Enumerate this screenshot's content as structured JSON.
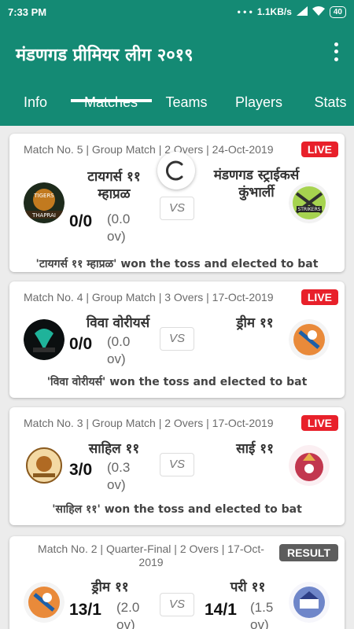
{
  "status_bar": {
    "time": "7:33 PM",
    "dots": "• • •",
    "speed": "1.1KB/s",
    "battery": "40"
  },
  "app": {
    "title": "मंडणगड प्रीमियर लीग २०१९"
  },
  "tabs": [
    {
      "label": "Info"
    },
    {
      "label": "Matches",
      "selected": true
    },
    {
      "label": "Teams"
    },
    {
      "label": "Players"
    },
    {
      "label": "Stats"
    }
  ],
  "matches": [
    {
      "meta": "Match No. 5 | Group Match | 2 Overs | 24-Oct-2019",
      "status": "LIVE",
      "team1": {
        "name": "टायगर्स ११ म्हाप्रळ",
        "score": "0/0",
        "overs": "(0.0 ov)"
      },
      "vs": "VS",
      "team2": {
        "name": "मंडणगड स्ट्राईकर्स कुंभार्ली"
      },
      "toss": "'टायगर्स ११ म्हाप्रळ' won the toss and elected to bat"
    },
    {
      "meta": "Match No. 4 | Group Match | 3 Overs | 17-Oct-2019",
      "status": "LIVE",
      "team1": {
        "name": "विवा वोरीयर्स",
        "score": "0/0",
        "overs": "(0.0 ov)"
      },
      "vs": "VS",
      "team2": {
        "name": "ड्रीम ११"
      },
      "toss": "'विवा वोरीयर्स' won the toss and elected to bat"
    },
    {
      "meta": "Match No. 3 | Group Match | 2 Overs | 17-Oct-2019",
      "status": "LIVE",
      "team1": {
        "name": "साहिल ११",
        "score": "3/0",
        "overs": "(0.3 ov)"
      },
      "vs": "VS",
      "team2": {
        "name": "साई ११"
      },
      "toss": "'साहिल ११' won the toss and elected to bat"
    },
    {
      "meta": "Match No. 2 | Quarter-Final | 2 Overs | 17-Oct-2019",
      "status": "RESULT",
      "team1": {
        "name": "ड्रीम ११",
        "score": "13/1",
        "overs": "(2.0 ov)"
      },
      "vs": "VS",
      "team2": {
        "name": "परी ११",
        "score": "14/1",
        "overs": "(1.5 ov)"
      }
    }
  ],
  "logo_texts": {
    "tigers": "TIGERS",
    "thaprai": "THAPRAI",
    "strikers": "STRIKERS"
  },
  "colors": {
    "primary": "#148a74",
    "live": "#e8202a",
    "result": "#5d5d5d"
  }
}
